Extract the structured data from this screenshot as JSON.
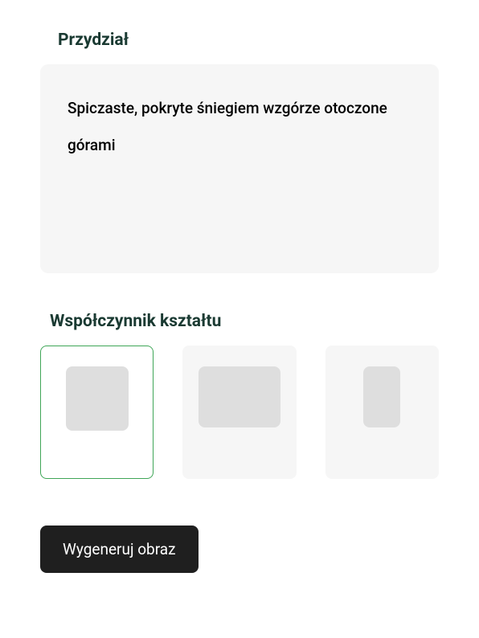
{
  "prompt": {
    "label": "Przydział",
    "text": "Spiczaste, pokryte śniegiem wzgórze otoczone górami"
  },
  "aspectRatio": {
    "label": "Współczynnik kształtu",
    "options": [
      {
        "type": "square",
        "selected": true
      },
      {
        "type": "landscape",
        "selected": false
      },
      {
        "type": "portrait",
        "selected": false
      }
    ]
  },
  "actions": {
    "generate": "Wygeneruj obraz"
  }
}
